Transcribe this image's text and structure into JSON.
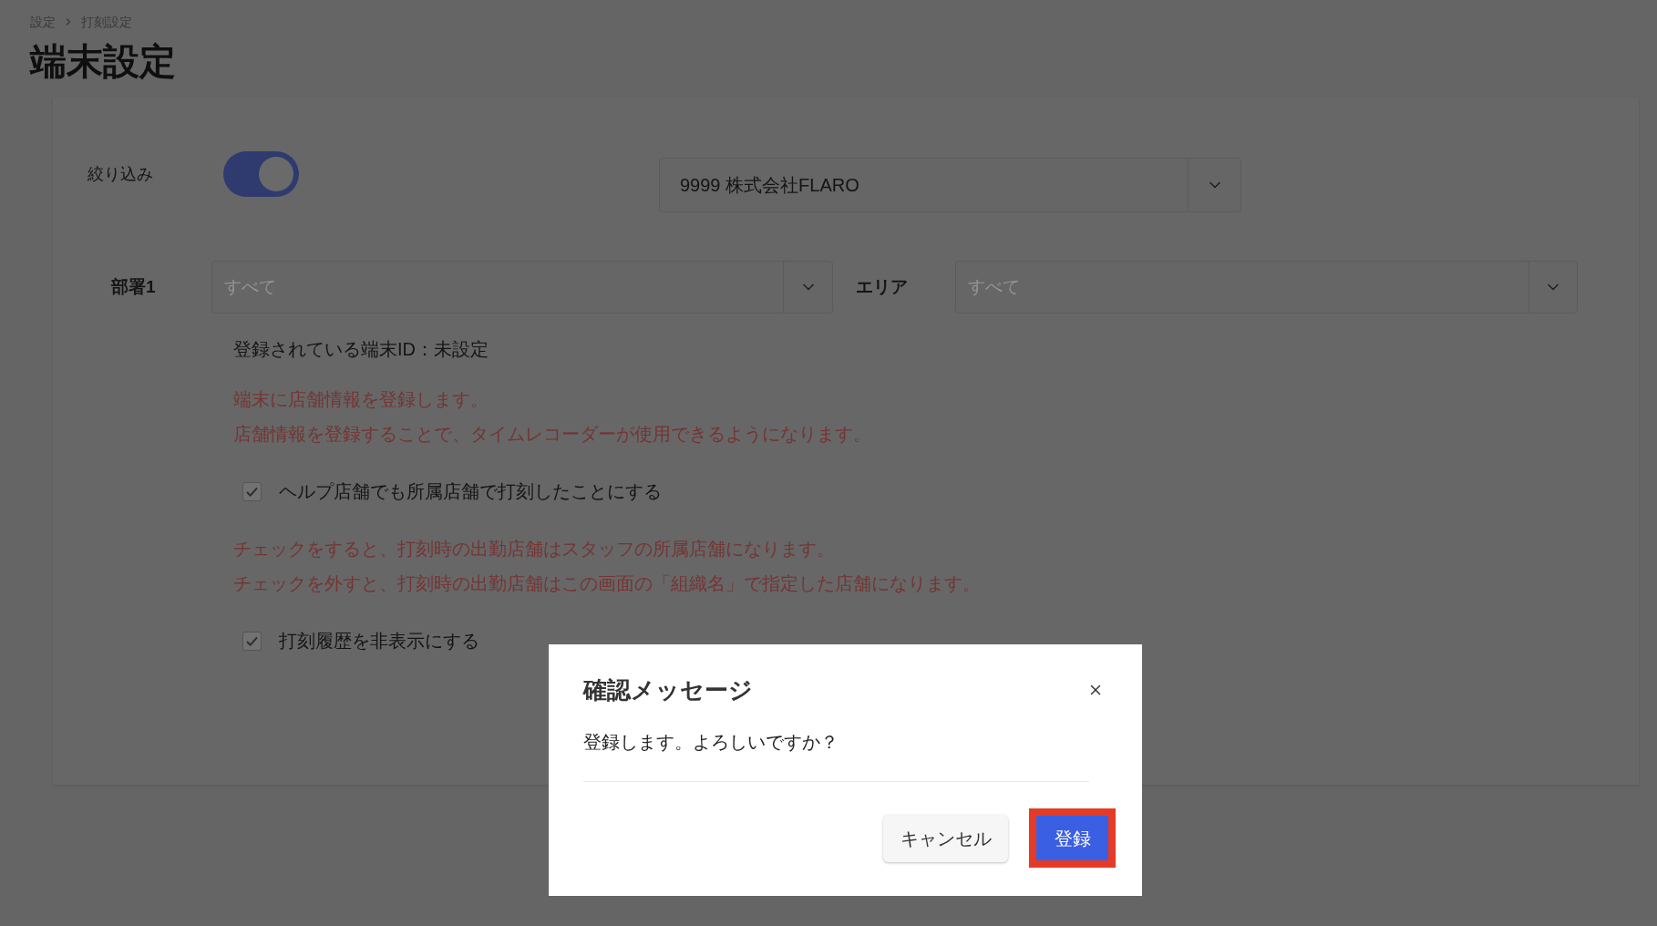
{
  "breadcrumb": [
    {
      "label": "設定"
    },
    {
      "label": "打刻設定"
    }
  ],
  "page_title": "端末設定",
  "filter": {
    "label": "絞り込み",
    "on": true
  },
  "company_select": {
    "value": "9999 株式会社FLARO"
  },
  "department_select": {
    "label": "部署1",
    "placeholder": "すべて"
  },
  "area_select": {
    "label": "エリア",
    "placeholder": "すべて"
  },
  "sections": [
    {
      "kind": "text",
      "text": "登録されている端末ID：未設定"
    },
    {
      "kind": "note",
      "lines": [
        "端末に店舗情報を登録します。",
        "店舗情報を登録することで、タイムレコーダーが使用できるようになります。"
      ]
    },
    {
      "kind": "checkbox",
      "label": "ヘルプ店舗でも所属店舗で打刻したことにする",
      "checked": true,
      "disabled": true
    },
    {
      "kind": "note",
      "lines": [
        "チェックをすると、打刻時の出勤店舗はスタッフの所属店舗になります。",
        "チェックを外すと、打刻時の出勤店舗はこの画面の「組織名」で指定した店舗になります。"
      ]
    },
    {
      "kind": "checkbox",
      "label": "打刻履歴を非表示にする",
      "checked": true,
      "disabled": true
    }
  ],
  "dialog": {
    "title": "確認メッセージ",
    "message": "登録します。よろしいですか？",
    "buttons": [
      {
        "label": "キャンセル",
        "kind": "secondary",
        "highlighted": false
      },
      {
        "label": "登録",
        "kind": "primary",
        "highlighted": true
      }
    ]
  }
}
